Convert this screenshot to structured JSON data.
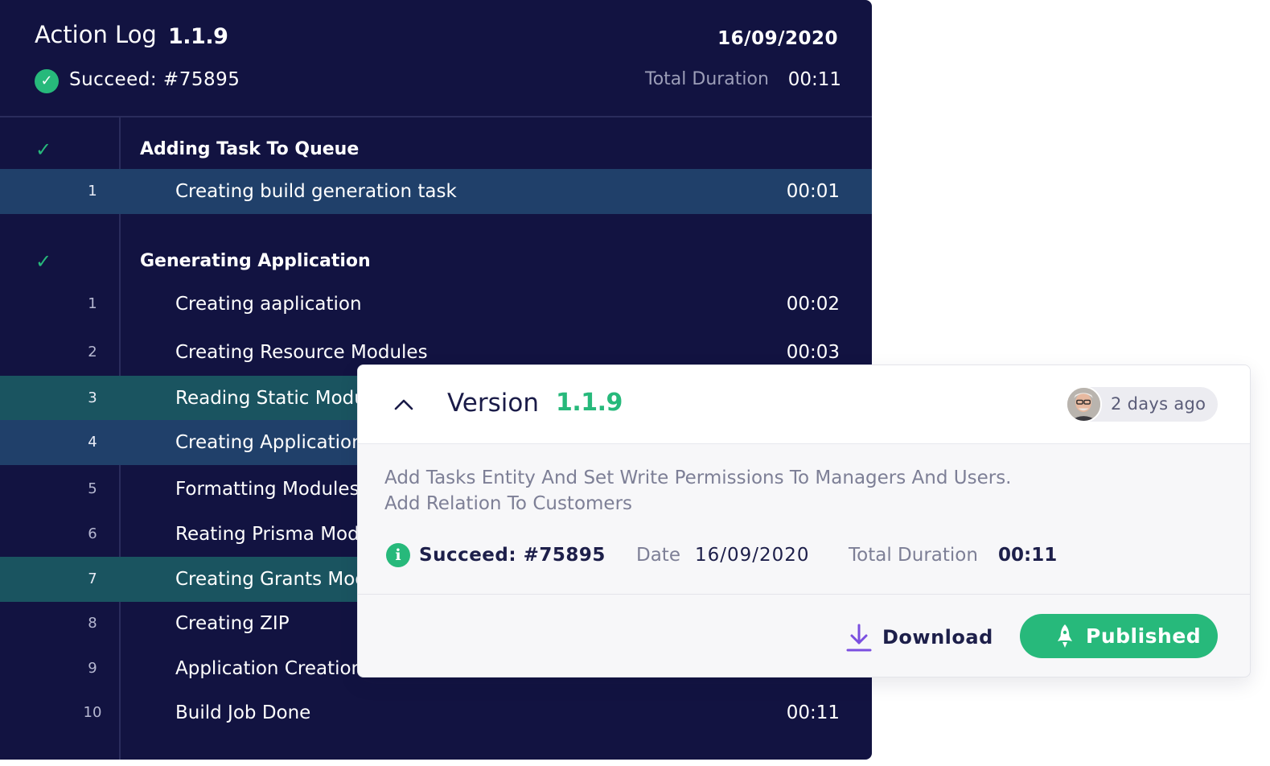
{
  "action_log": {
    "title": "Action Log",
    "version": "1.1.9",
    "date": "16/09/2020",
    "status": "Succeed: #75895",
    "total_duration_label": "Total Duration",
    "total_duration": "00:11",
    "sections": [
      {
        "title": "Adding Task To Queue",
        "steps": [
          {
            "num": "1",
            "label": "Creating build generation task",
            "time": "00:01",
            "highlight": "blue"
          }
        ]
      },
      {
        "title": "Generating Application",
        "steps": [
          {
            "num": "1",
            "label": "Creating aaplication",
            "time": "00:02",
            "highlight": "none"
          },
          {
            "num": "2",
            "label": "Creating Resource Modules",
            "time": "00:03",
            "highlight": "none"
          },
          {
            "num": "3",
            "label": "Reading Static Modules",
            "time": "",
            "highlight": "teal"
          },
          {
            "num": "4",
            "label": "Creating Application",
            "time": "",
            "highlight": "blue"
          },
          {
            "num": "5",
            "label": "Formatting Modules",
            "time": "",
            "highlight": "none"
          },
          {
            "num": "6",
            "label": "Reating Prisma Modules",
            "time": "",
            "highlight": "none"
          },
          {
            "num": "7",
            "label": "Creating Grants Modules",
            "time": "",
            "highlight": "teal"
          },
          {
            "num": "8",
            "label": "Creating ZIP",
            "time": "",
            "highlight": "none"
          },
          {
            "num": "9",
            "label": "Application Creation",
            "time": "",
            "highlight": "none"
          },
          {
            "num": "10",
            "label": "Build Job Done",
            "time": "00:11",
            "highlight": "none"
          }
        ]
      }
    ]
  },
  "version_card": {
    "version_label": "Version",
    "version": "1.1.9",
    "time_ago": "2 days ago",
    "description_line1": "Add Tasks Entity And Set Write Permissions To Managers And Users.",
    "description_line2": "Add Relation To Customers",
    "status": "Succeed: #75895",
    "date_label": "Date",
    "date": "16/09/2020",
    "total_duration_label": "Total Duration",
    "total_duration": "00:11",
    "download_label": "Download",
    "published_label": "Published"
  },
  "colors": {
    "panel_bg": "#121341",
    "accent_green": "#27b97b",
    "row_blue": "#20406a",
    "row_teal": "#1a5460",
    "download_icon": "#7b4fe0"
  },
  "icons": {
    "status": "check-circle-icon",
    "section": "check-icon",
    "collapse": "chevron-up-icon",
    "info": "info-icon",
    "download": "download-icon",
    "published": "rocket-icon"
  }
}
